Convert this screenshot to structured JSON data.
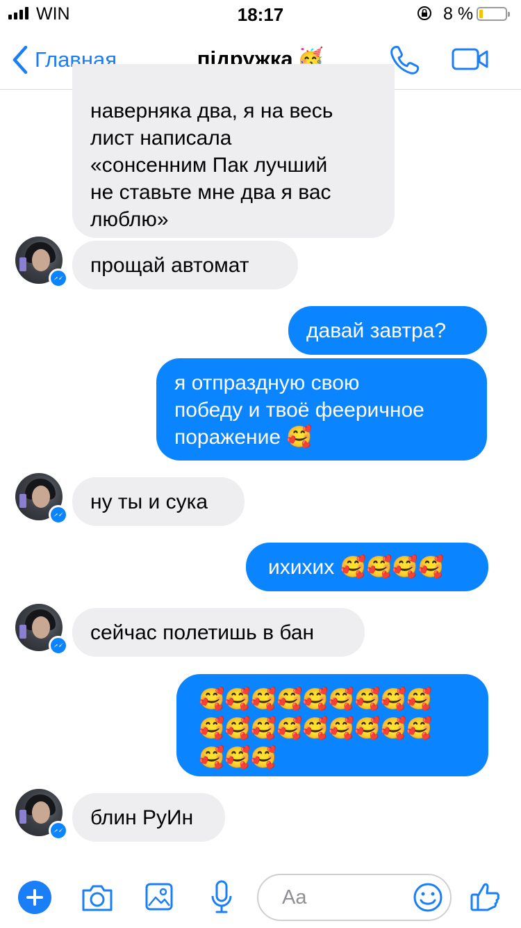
{
  "status_bar": {
    "carrier": "WIN",
    "time": "18:17",
    "battery": "8 %",
    "battery_level": 0.08
  },
  "header": {
    "back_label": "Главная",
    "title": "підружка",
    "title_emoji": "🥳",
    "icons": {
      "back": "chevron-left-icon",
      "call": "phone-icon",
      "video": "video-camera-icon"
    },
    "accent_color": "#1a7ef7"
  },
  "messages": [
    {
      "from": "them",
      "text": "наверняка два, я на весь\nлист написала\n«сонсенним Пак лучший\nне ставьте мне два я вас\nлюблю»"
    },
    {
      "from": "them",
      "text": "прощай автомат"
    },
    {
      "from": "me",
      "text": "давай завтра?"
    },
    {
      "from": "me",
      "text": "я отпраздную свою\nпобеду и твоё фееричное\nпоражение 🥰"
    },
    {
      "from": "them",
      "text": "ну ты и сука"
    },
    {
      "from": "me",
      "text": "ихихих 🥰🥰🥰🥰"
    },
    {
      "from": "them",
      "text": "сейчас полетишь в бан"
    },
    {
      "from": "me",
      "text": "🥰🥰🥰🥰🥰🥰🥰🥰🥰\n🥰🥰🥰🥰🥰🥰🥰🥰🥰\n🥰🥰🥰"
    },
    {
      "from": "them",
      "text": "блин РуИн"
    }
  ],
  "colors": {
    "outgoing_bubble": "#0a84ff",
    "incoming_bubble": "#eeeef0"
  },
  "composer": {
    "placeholder": "Aa",
    "icons": [
      "plus-icon",
      "camera-icon",
      "photo-icon",
      "microphone-icon",
      "smiley-icon",
      "thumbs-up-icon"
    ]
  }
}
